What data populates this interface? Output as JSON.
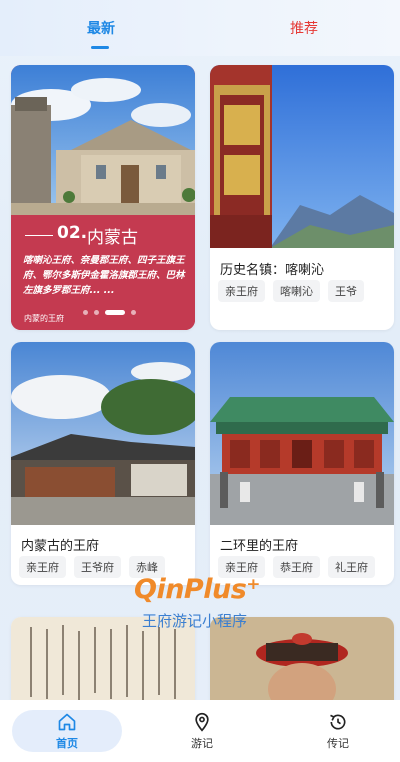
{
  "tabs": {
    "latest": "最新",
    "recommend": "推荐"
  },
  "feature": {
    "number": "02.",
    "region": "内蒙古",
    "description": "喀喇沁王府、奈曼郡王府、四子王旗王府、鄂尔多斯伊金霍洛旗郡王府、巴林左旗多罗郡王府... ...",
    "caption": "内蒙的王府",
    "slide_index": 3,
    "slide_count": 4
  },
  "cards": [
    {
      "title": "历史名镇：喀喇沁",
      "tags": [
        "亲王府",
        "喀喇沁",
        "王爷"
      ]
    },
    {
      "title": "内蒙古的王府",
      "tags": [
        "亲王府",
        "王爷府",
        "赤峰"
      ]
    },
    {
      "title": "二环里的王府",
      "tags": [
        "亲王府",
        "恭王府",
        "礼王府"
      ]
    }
  ],
  "watermark": {
    "logo": "QinPlus⁺",
    "subtitle": "王府游记小程序"
  },
  "nav": {
    "home": "首页",
    "travel": "游记",
    "biography": "传记"
  },
  "colors": {
    "accent": "#1e88e5",
    "recommend": "#e53935",
    "feature_panel": "#c43a50"
  },
  "icons": {
    "home": "home-icon",
    "travel": "map-pin-icon",
    "biography": "history-icon"
  }
}
